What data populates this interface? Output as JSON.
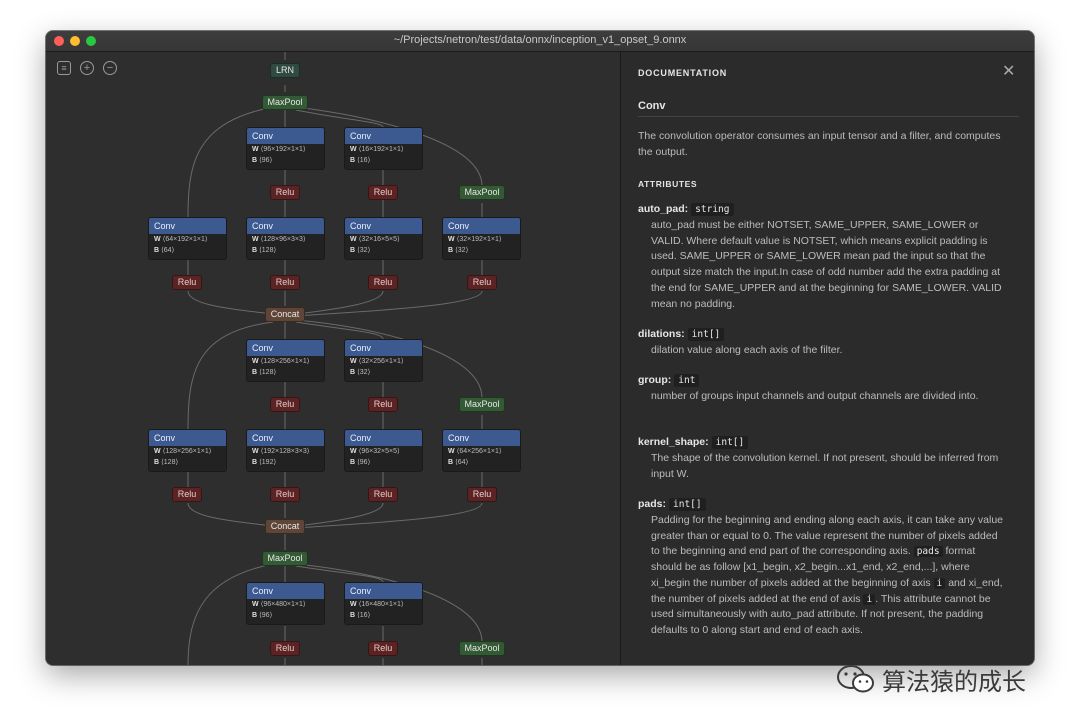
{
  "window": {
    "title": "~/Projects/netron/test/data/onnx/inception_v1_opset_9.onnx"
  },
  "toolbar": {
    "menu": "≡",
    "zoom_in": "+",
    "zoom_out": "−"
  },
  "graph": {
    "lrn": "LRN",
    "maxpool": "MaxPool",
    "concat": "Concat",
    "relu": "Relu",
    "conv_title": "Conv",
    "convs": [
      {
        "w": "⟨96×192×1×1⟩",
        "b": "⟨96⟩"
      },
      {
        "w": "⟨16×192×1×1⟩",
        "b": "⟨16⟩"
      },
      {
        "w": "⟨64×192×1×1⟩",
        "b": "⟨64⟩"
      },
      {
        "w": "⟨128×96×3×3⟩",
        "b": "⟨128⟩"
      },
      {
        "w": "⟨32×16×5×5⟩",
        "b": "⟨32⟩"
      },
      {
        "w": "⟨32×192×1×1⟩",
        "b": "⟨32⟩"
      },
      {
        "w": "⟨128×256×1×1⟩",
        "b": "⟨128⟩"
      },
      {
        "w": "⟨32×256×1×1⟩",
        "b": "⟨32⟩"
      },
      {
        "w": "⟨128×256×1×1⟩",
        "b": "⟨128⟩"
      },
      {
        "w": "⟨192×128×3×3⟩",
        "b": "⟨192⟩"
      },
      {
        "w": "⟨96×32×5×5⟩",
        "b": "⟨96⟩"
      },
      {
        "w": "⟨64×256×1×1⟩",
        "b": "⟨64⟩"
      },
      {
        "w": "⟨96×480×1×1⟩",
        "b": "⟨96⟩"
      },
      {
        "w": "⟨16×480×1×1⟩",
        "b": "⟨16⟩"
      }
    ],
    "w_label": "W",
    "b_label": "B"
  },
  "documentation": {
    "heading": "DOCUMENTATION",
    "close": "✕",
    "op_name": "Conv",
    "op_description": "The convolution operator consumes an input tensor and a filter, and computes the output.",
    "attributes_heading": "ATTRIBUTES",
    "attributes": [
      {
        "name": "auto_pad:",
        "type": "string",
        "description": "auto_pad must be either NOTSET, SAME_UPPER, SAME_LOWER or VALID. Where default value is NOTSET, which means explicit padding is used. SAME_UPPER or SAME_LOWER mean pad the input so that the output size match the input.In case of odd number add the extra padding at the end for SAME_UPPER and at the beginning for SAME_LOWER. VALID mean no padding."
      },
      {
        "name": "dilations:",
        "type": "int[]",
        "description": "dilation value along each axis of the filter."
      },
      {
        "name": "group:",
        "type": "int",
        "description": "number of groups input channels and output channels are divided into."
      },
      {
        "name": "kernel_shape:",
        "type": "int[]",
        "description": "The shape of the convolution kernel. If not present, should be inferred from input W."
      },
      {
        "name": "pads:",
        "type": "int[]",
        "description_p1": "Padding for the beginning and ending along each axis, it can take any value greater than or equal to 0. The value represent the number of pixels added to the beginning and end part of the corresponding axis.",
        "code_pads": "pads",
        "description_p2": "format should be as follow [x1_begin, x2_begin...x1_end, x2_end,...], where xi_begin the number of pixels added at the beginning of axis",
        "code_i": "i",
        "description_p3": "and xi_end, the number of pixels added at the end of axis",
        "description_p4": ". This attribute cannot be used simultaneously with auto_pad attribute. If not present, the padding defaults to 0 along start and end of each axis."
      }
    ]
  },
  "watermark": {
    "text": "算法猿的成长"
  }
}
